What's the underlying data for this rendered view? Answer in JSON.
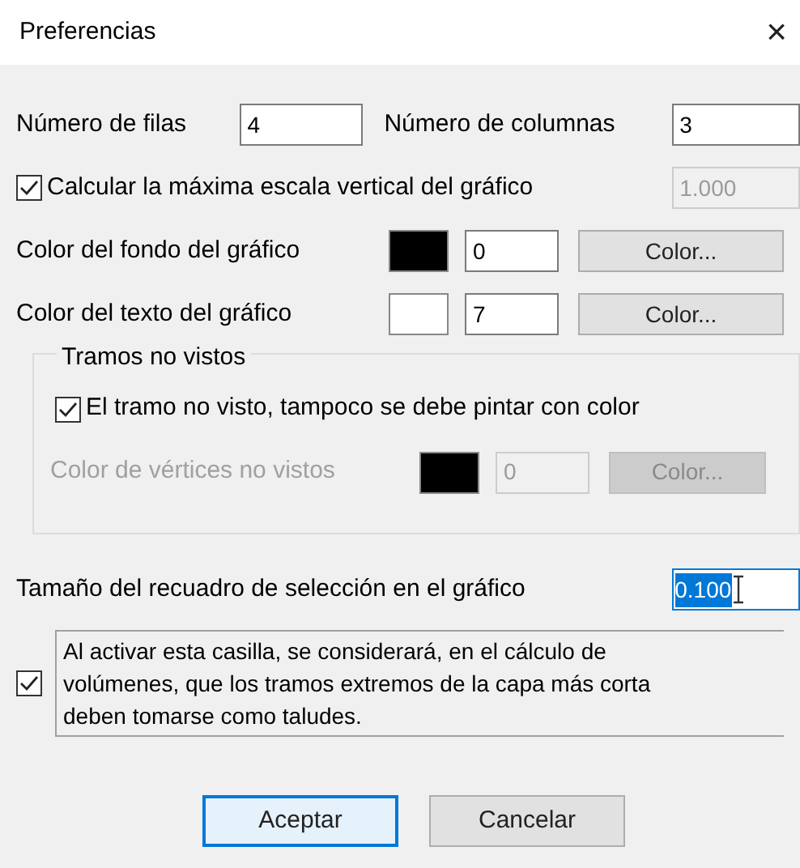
{
  "window": {
    "title": "Preferencias",
    "close": "×"
  },
  "grid": {
    "rows": {
      "label": "Número de filas",
      "value": "4"
    },
    "columns": {
      "label": "Número de columnas",
      "value": "3"
    }
  },
  "max_scale": {
    "label": "Calcular la máxima escala vertical  del gráfico",
    "checked": true,
    "value": "1.000",
    "disabled": true
  },
  "colors": [
    {
      "label": "Color del fondo del gráfico",
      "color": "#000000",
      "value": "0",
      "button": "Color...",
      "disabled": false
    },
    {
      "label": "Color del texto del gráfico",
      "color": "#ffffff",
      "value": "7",
      "button": "Color...",
      "disabled": false
    }
  ],
  "hidden_group": {
    "title": "Tramos no vistos",
    "checkbox": {
      "label": "El tramo no visto, tampoco se debe pintar con color",
      "checked": true
    },
    "vertex_color": {
      "label": "Color de vértices no vistos",
      "color": "#000000",
      "value": "0",
      "button": "Color...",
      "disabled": true
    }
  },
  "selection_size": {
    "label": "Tamaño del recuadro de selección en el gráfico",
    "value": "0.100",
    "selected": true
  },
  "slopes": {
    "checked": true,
    "text": "Al activar esta casilla, se considerará, en el cálculo de volúmenes, que los tramos extremos de la capa más corta deben tomarse como taludes."
  },
  "buttons": [
    {
      "label": "Aceptar",
      "default": true
    },
    {
      "label": "Cancelar",
      "default": false
    }
  ]
}
